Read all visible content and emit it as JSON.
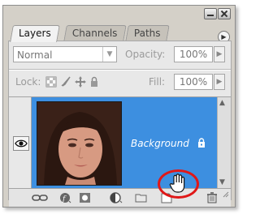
{
  "tabs": [
    {
      "label": "Layers"
    },
    {
      "label": "Channels"
    },
    {
      "label": "Paths"
    }
  ],
  "blend_mode": {
    "value": "Normal"
  },
  "opacity": {
    "label": "Opacity:",
    "value": "100%"
  },
  "lock": {
    "label": "Lock:"
  },
  "fill": {
    "label": "Fill:",
    "value": "100%"
  },
  "layers": [
    {
      "name": "Background",
      "selected": true,
      "visible": true,
      "locked": true
    }
  ],
  "bottom_icons": [
    "link-layers-icon",
    "layer-style-icon",
    "add-mask-icon",
    "adjustment-layer-icon",
    "new-group-icon",
    "new-layer-icon",
    "delete-layer-icon"
  ],
  "colors": {
    "selection": "#3d8fe0",
    "highlight_circle": "#e01818"
  }
}
